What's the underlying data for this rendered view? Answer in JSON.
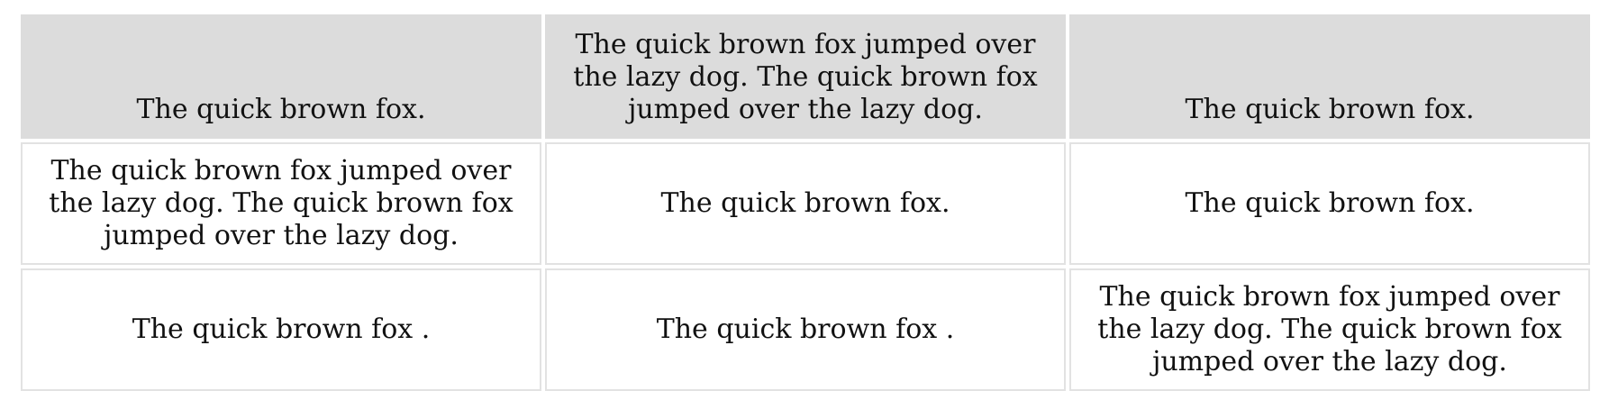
{
  "table": {
    "rows": [
      {
        "cells": [
          "The quick brown fox.",
          "The quick brown fox jumped over the lazy dog. The quick brown fox jumped over the lazy dog.",
          "The quick brown fox."
        ]
      },
      {
        "cells": [
          "The quick brown fox jumped over the lazy dog. The quick brown fox jumped over the lazy dog.",
          "The quick brown fox.",
          "The quick brown fox."
        ]
      },
      {
        "cells": [
          "The quick brown fox .",
          "The quick brown fox .",
          "The quick brown fox jumped over the lazy dog. The quick brown fox jumped over the lazy dog."
        ]
      }
    ]
  },
  "colors": {
    "header_background": "#dcdcdc",
    "cell_border": "#e2e2e2",
    "text": "#111111"
  }
}
